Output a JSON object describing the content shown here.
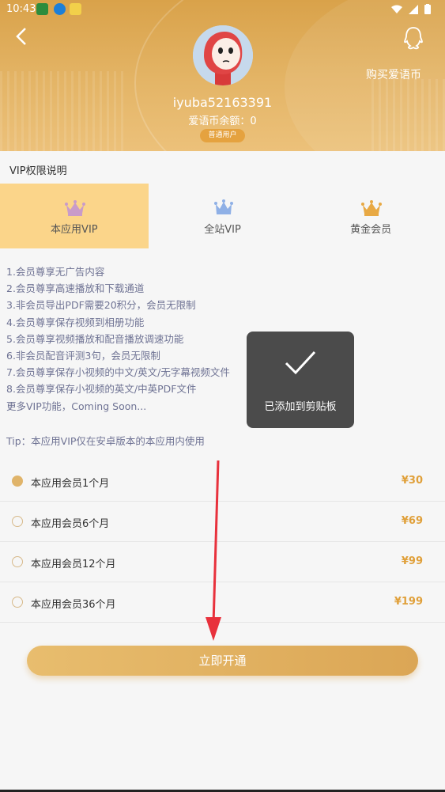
{
  "status_bar": {
    "time": "10:43"
  },
  "header": {
    "buy_link": "购买爱语币",
    "username": "iyuba52163391",
    "balance": "爱语币余额：0",
    "badge": "普通用户"
  },
  "section_title": "VIP权限说明",
  "tabs": [
    {
      "label": "本应用VIP",
      "active": true
    },
    {
      "label": "全站VIP",
      "active": false
    },
    {
      "label": "黄金会员",
      "active": false
    }
  ],
  "features": [
    "1.会员尊享无广告内容",
    "2.会员尊享高速播放和下载通道",
    "3.非会员导出PDF需要20积分，会员无限制",
    "4.会员尊享保存视频到相册功能",
    "5.会员尊享视频播放和配音播放调速功能",
    "6.非会员配音评测3句，会员无限制",
    "7.会员尊享保存小视频的中文/英文/无字幕视频文件",
    "8.会员尊享保存小视频的英文/中英PDF文件",
    "更多VIP功能，Coming Soon..."
  ],
  "tip": "Tip：本应用VIP仅在安卓版本的本应用内使用",
  "plans": [
    {
      "name": "本应用会员1个月",
      "price": "¥30",
      "selected": true
    },
    {
      "name": "本应用会员6个月",
      "price": "¥69",
      "selected": false
    },
    {
      "name": "本应用会员12个月",
      "price": "¥99",
      "selected": false
    },
    {
      "name": "本应用会员36个月",
      "price": "¥199",
      "selected": false
    }
  ],
  "cta": "立即开通",
  "toast": {
    "message": "已添加到剪贴板"
  },
  "colors": {
    "accent": "#e0a03a",
    "header": "#e4b567",
    "tab_active": "#fbd58a"
  }
}
